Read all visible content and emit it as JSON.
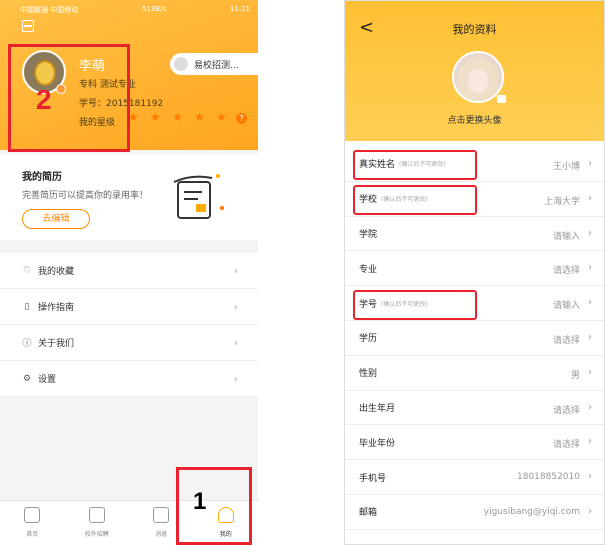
{
  "left": {
    "status": {
      "carrier": "中国联通 中国移动",
      "speed": "513B/s",
      "time": "11:21"
    },
    "profile": {
      "name": "李萌",
      "degree": "专科 测试专业",
      "student_id": "学号：2015181192",
      "stars_label": "我的星级",
      "rating": 5,
      "school_pill": "易校招测..."
    },
    "resume": {
      "title": "我的简历",
      "desc": "完善简历可以提高你的录用率！",
      "edit_button": "去编辑"
    },
    "menu": [
      {
        "label": "我的收藏",
        "icon": "heart-icon"
      },
      {
        "label": "操作指南",
        "icon": "guide-icon"
      },
      {
        "label": "关于我们",
        "icon": "info-icon"
      },
      {
        "label": "设置",
        "icon": "settings-icon"
      }
    ],
    "tabs": [
      {
        "label": "首页",
        "icon": "home-icon"
      },
      {
        "label": "校外招聘",
        "icon": "briefcase-icon"
      },
      {
        "label": "消息",
        "icon": "message-icon"
      },
      {
        "label": "我的",
        "icon": "user-icon"
      }
    ],
    "annotations": {
      "box1": "1",
      "box2": "2"
    },
    "colors": {
      "accent": "#ffa51f",
      "highlight": "#e8232d"
    }
  },
  "right": {
    "title": "我的资料",
    "back": "<",
    "change_avatar": "点击更换头像",
    "fields": [
      {
        "label": "真实姓名",
        "note": "(确认后不可更改)",
        "value": "王小博"
      },
      {
        "label": "学校",
        "note": "(确认后不可更改)",
        "value": "上海大学"
      },
      {
        "label": "学院",
        "note": "",
        "value": "请输入"
      },
      {
        "label": "专业",
        "note": "",
        "value": "请选择"
      },
      {
        "label": "学号",
        "note": "(确认后不可更改)",
        "value": "请输入"
      },
      {
        "label": "学历",
        "note": "",
        "value": "请选择"
      },
      {
        "label": "性别",
        "note": "",
        "value": "男"
      },
      {
        "label": "出生年月",
        "note": "",
        "value": "请选择"
      },
      {
        "label": "毕业年份",
        "note": "",
        "value": "请选择"
      },
      {
        "label": "手机号",
        "note": "",
        "value": "18018852010"
      },
      {
        "label": "邮箱",
        "note": "",
        "value": "yigusibang@yiqi.com"
      }
    ]
  }
}
